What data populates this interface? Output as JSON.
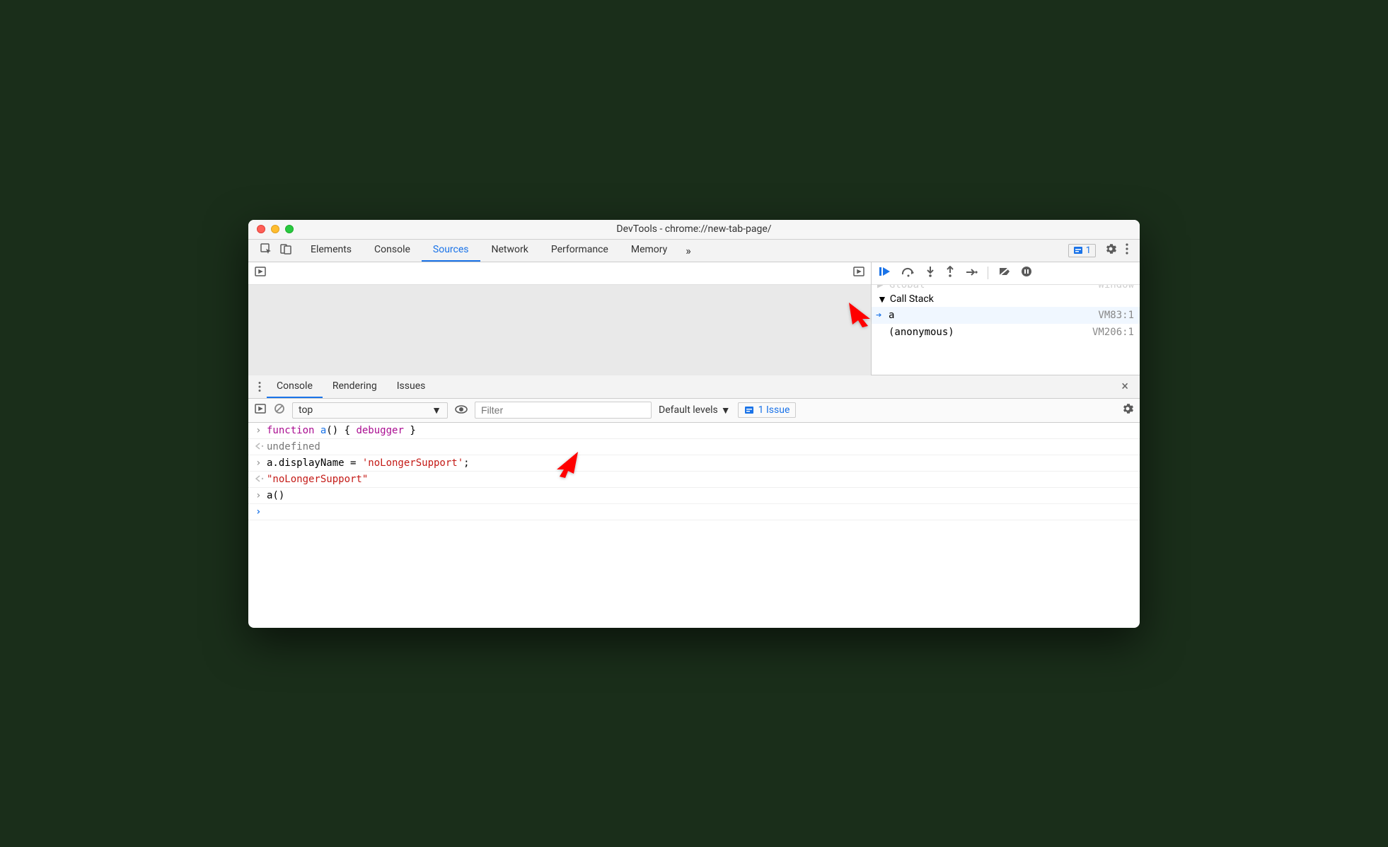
{
  "window": {
    "title": "DevTools - chrome://new-tab-page/"
  },
  "tabs": {
    "items": [
      "Elements",
      "Console",
      "Sources",
      "Network",
      "Performance",
      "Memory"
    ],
    "active": "Sources",
    "more": "»",
    "issue_count": "1"
  },
  "debugger": {
    "scope_truncated": {
      "name": "Global",
      "value": "Window"
    },
    "callstack_header": "Call Stack",
    "stack": [
      {
        "name": "a",
        "loc": "VM83:1",
        "current": true
      },
      {
        "name": "(anonymous)",
        "loc": "VM206:1",
        "current": false
      }
    ]
  },
  "drawer": {
    "tabs": [
      "Console",
      "Rendering",
      "Issues"
    ],
    "active": "Console"
  },
  "console_toolbar": {
    "context": "top",
    "filter_placeholder": "Filter",
    "levels": "Default levels",
    "issue_button": "1 Issue"
  },
  "console": {
    "lines": [
      {
        "kind": "in",
        "segments": [
          [
            "kw",
            "function "
          ],
          [
            "fn",
            "a"
          ],
          [
            "plain",
            "() { "
          ],
          [
            "dbg",
            "debugger"
          ],
          [
            "plain",
            " }"
          ]
        ]
      },
      {
        "kind": "out",
        "segments": [
          [
            "undef",
            "undefined"
          ]
        ]
      },
      {
        "kind": "in",
        "segments": [
          [
            "plain",
            "a.displayName = "
          ],
          [
            "str",
            "'noLongerSupport'"
          ],
          [
            "plain",
            ";"
          ]
        ]
      },
      {
        "kind": "out",
        "segments": [
          [
            "str",
            "\"noLongerSupport\""
          ]
        ]
      },
      {
        "kind": "in",
        "segments": [
          [
            "plain",
            "a()"
          ]
        ]
      },
      {
        "kind": "live",
        "segments": []
      }
    ]
  },
  "colors": {
    "accent": "#1a73e8",
    "annotation": "#ff0000"
  }
}
